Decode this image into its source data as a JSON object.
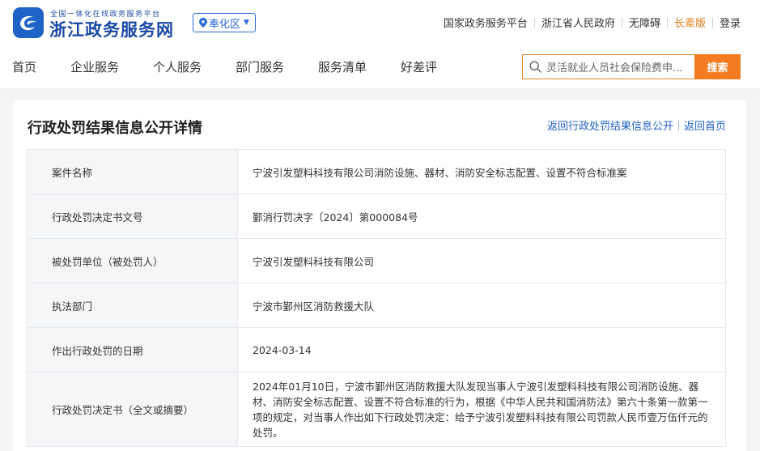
{
  "header": {
    "logo_subtitle": "全国一体化在线政务服务平台",
    "logo_title": "浙江政务服务网",
    "region_label": "奉化区",
    "top_links": [
      "国家政务服务平台",
      "浙江省人民政府",
      "无障碍",
      "长辈版",
      "登录"
    ]
  },
  "nav": {
    "items": [
      "首页",
      "企业服务",
      "个人服务",
      "部门服务",
      "服务清单",
      "好差评"
    ],
    "search_value": "灵活就业人员社会保险费申...",
    "search_button": "搜索"
  },
  "detail": {
    "title": "行政处罚结果信息公开详情",
    "back_link": "返回行政处罚结果信息公开",
    "home_link": "返回首页",
    "rows": [
      {
        "label": "案件名称",
        "value": "宁波引发塑料科技有限公司消防设施、器材、消防安全标志配置、设置不符合标准案"
      },
      {
        "label": "行政处罚决定书文号",
        "value": "鄞消行罚决字〔2024〕第000084号"
      },
      {
        "label": "被处罚单位（被处罚人）",
        "value": "宁波引发塑料科技有限公司"
      },
      {
        "label": "执法部门",
        "value": "宁波市鄞州区消防救援大队"
      },
      {
        "label": "作出行政处罚的日期",
        "value": "2024-03-14"
      },
      {
        "label": "行政处罚决定书（全文或摘要）",
        "value": "2024年01月10日，宁波市鄞州区消防救援大队发现当事人宁波引发塑料科技有限公司消防设施、器材、消防安全标志配置、设置不符合标准的行为，根据《中华人民共和国消防法》第六十条第一款第一项的规定，对当事人作出如下行政处罚决定：给予宁波引发塑料科技有限公司罚款人民币壹万伍仟元的处罚。"
      }
    ]
  },
  "colors": {
    "brand_blue": "#1f62c6",
    "link_blue": "#2060c8",
    "accent_orange": "#f47b20"
  },
  "icons": {
    "logo": "zhejiang-gov-logo-icon",
    "region": "location-pin-icon",
    "search": "search-icon"
  }
}
